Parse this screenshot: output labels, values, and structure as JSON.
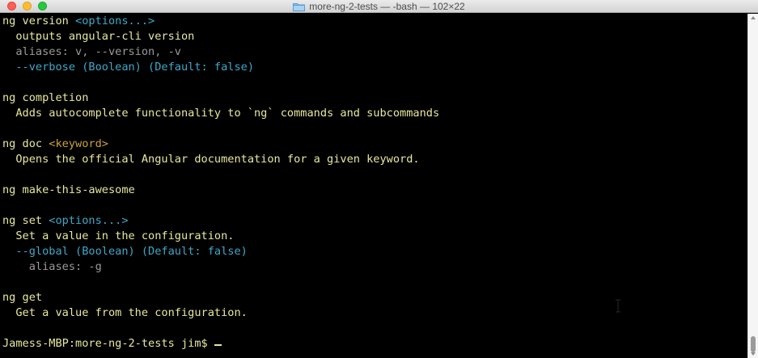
{
  "window": {
    "title": "more-ng-2-tests — -bash — 102×22"
  },
  "terminal": {
    "lines": [
      {
        "parts": [
          {
            "t": "ng version ",
            "c": "y"
          },
          {
            "t": "<options...>",
            "c": "c"
          }
        ]
      },
      {
        "parts": [
          {
            "t": "  outputs angular-cli version",
            "c": "y"
          }
        ]
      },
      {
        "parts": [
          {
            "t": "  aliases: v, --version, -v",
            "c": "g"
          }
        ]
      },
      {
        "parts": [
          {
            "t": "  --verbose (Boolean) (Default: false)",
            "c": "c"
          }
        ]
      },
      {
        "parts": [
          {
            "t": "",
            "c": "y"
          }
        ]
      },
      {
        "parts": [
          {
            "t": "ng completion",
            "c": "y"
          }
        ]
      },
      {
        "parts": [
          {
            "t": "  Adds autocomplete functionality to `ng` commands and subcommands",
            "c": "y"
          }
        ]
      },
      {
        "parts": [
          {
            "t": "",
            "c": "y"
          }
        ]
      },
      {
        "parts": [
          {
            "t": "ng doc ",
            "c": "y"
          },
          {
            "t": "<keyword>",
            "c": "o"
          }
        ]
      },
      {
        "parts": [
          {
            "t": "  Opens the official Angular documentation for a given keyword.",
            "c": "y"
          }
        ]
      },
      {
        "parts": [
          {
            "t": "",
            "c": "y"
          }
        ]
      },
      {
        "parts": [
          {
            "t": "ng make-this-awesome",
            "c": "y"
          }
        ]
      },
      {
        "parts": [
          {
            "t": "",
            "c": "y"
          }
        ]
      },
      {
        "parts": [
          {
            "t": "ng set ",
            "c": "y"
          },
          {
            "t": "<options...>",
            "c": "c"
          }
        ]
      },
      {
        "parts": [
          {
            "t": "  Set a value in the configuration.",
            "c": "y"
          }
        ]
      },
      {
        "parts": [
          {
            "t": "  --global (Boolean) (Default: false)",
            "c": "c"
          }
        ]
      },
      {
        "parts": [
          {
            "t": "    aliases: -g",
            "c": "g"
          }
        ]
      },
      {
        "parts": [
          {
            "t": "",
            "c": "y"
          }
        ]
      },
      {
        "parts": [
          {
            "t": "ng get",
            "c": "y"
          }
        ]
      },
      {
        "parts": [
          {
            "t": "  Get a value from the configuration.",
            "c": "y"
          }
        ]
      },
      {
        "parts": [
          {
            "t": "",
            "c": "y"
          }
        ]
      },
      {
        "parts": [
          {
            "t": "Jamess-MBP:more-ng-2-tests jim$ ",
            "c": "y"
          }
        ],
        "prompt": true
      }
    ]
  },
  "colors": {
    "background": "#000000",
    "yellow_text": "#e8e89c",
    "cyan_text": "#3fa8c9",
    "gray_text": "#9a9a9a",
    "orange_text": "#c9a23a"
  }
}
